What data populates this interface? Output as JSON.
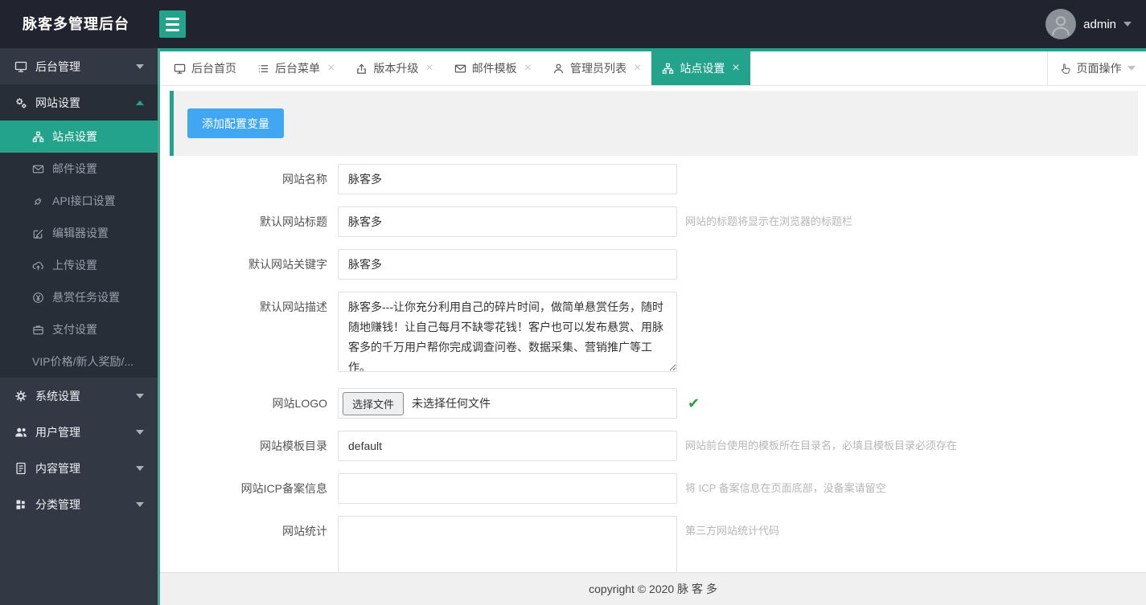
{
  "colors": {
    "accent": "#24a38c",
    "button_blue": "#41a7f2",
    "check_green": "#2f9e44"
  },
  "topbar": {
    "title": "脉客多管理后台",
    "username": "admin",
    "menu_icon": "hamburger-icon",
    "avatar_icon": "user-avatar-icon"
  },
  "sidebar": {
    "item_backend": {
      "label": "后台管理",
      "icon": "desktop-icon"
    },
    "group": {
      "label": "网站设置",
      "icon": "gears-icon",
      "items": [
        {
          "label": "站点设置",
          "icon": "sitemap-icon",
          "active": true
        },
        {
          "label": "邮件设置",
          "icon": "envelope-icon"
        },
        {
          "label": "API接口设置",
          "icon": "plug-icon"
        },
        {
          "label": "编辑器设置",
          "icon": "edit-icon"
        },
        {
          "label": "上传设置",
          "icon": "cloud-upload-icon"
        },
        {
          "label": "悬赏任务设置",
          "icon": "yen-circle-icon"
        },
        {
          "label": "支付设置",
          "icon": "wallet-icon"
        },
        {
          "label": "VIP价格/新人奖励/...",
          "icon": ""
        }
      ]
    },
    "items_after": [
      {
        "label": "系统设置",
        "icon": "gear-icon"
      },
      {
        "label": "用户管理",
        "icon": "users-icon"
      },
      {
        "label": "内容管理",
        "icon": "document-icon"
      },
      {
        "label": "分类管理",
        "icon": "grid-icon"
      }
    ]
  },
  "tabbar": {
    "close_glyph": "×",
    "tabs": [
      {
        "label": "后台首页",
        "icon": "desktop-icon",
        "closable": false,
        "active": false
      },
      {
        "label": "后台菜单",
        "icon": "list-icon",
        "closable": true,
        "active": false
      },
      {
        "label": "版本升级",
        "icon": "upload-icon",
        "closable": true,
        "active": false
      },
      {
        "label": "邮件模板",
        "icon": "envelope-icon",
        "closable": true,
        "active": false
      },
      {
        "label": "管理员列表",
        "icon": "user-icon",
        "closable": true,
        "active": false
      },
      {
        "label": "站点设置",
        "icon": "sitemap-icon",
        "closable": true,
        "active": true
      }
    ],
    "page_action": {
      "label": "页面操作",
      "icon": "hand-pointer-icon"
    }
  },
  "toolbar": {
    "add_button": "添加配置变量"
  },
  "form": {
    "fields": [
      {
        "label": "网站名称",
        "type": "input",
        "value": "脉客多",
        "hint": ""
      },
      {
        "label": "默认网站标题",
        "type": "input",
        "value": "脉客多",
        "hint": "网站的标题将显示在浏览器的标题栏"
      },
      {
        "label": "默认网站关键字",
        "type": "input",
        "value": "脉客多",
        "hint": ""
      },
      {
        "label": "默认网站描述",
        "type": "textarea",
        "value": "脉客多---让你充分利用自己的碎片时间，做简单悬赏任务，随时随地赚钱！让自己每月不缺零花钱！客户也可以发布悬赏、用脉客多的千万用户帮你完成调查问卷、数据采集、营销推广等工作。",
        "hint": ""
      },
      {
        "label": "网站LOGO",
        "type": "file",
        "button_label": "选择文件",
        "no_file_text": "未选择任何文件",
        "check_glyph": "✔",
        "hint": ""
      },
      {
        "label": "网站模板目录",
        "type": "input",
        "value": "default",
        "hint": "网站前台使用的模板所在目录名，必填且模板目录必须存在"
      },
      {
        "label": "网站ICP备案信息",
        "type": "input",
        "value": "",
        "hint": "将 ICP 备案信息在页面底部，没备案请留空"
      },
      {
        "label": "网站统计",
        "type": "textarea",
        "value": "",
        "hint": "第三方网站统计代码"
      }
    ]
  },
  "footer": {
    "copyright": "copyright © 2020 脉 客 多"
  }
}
